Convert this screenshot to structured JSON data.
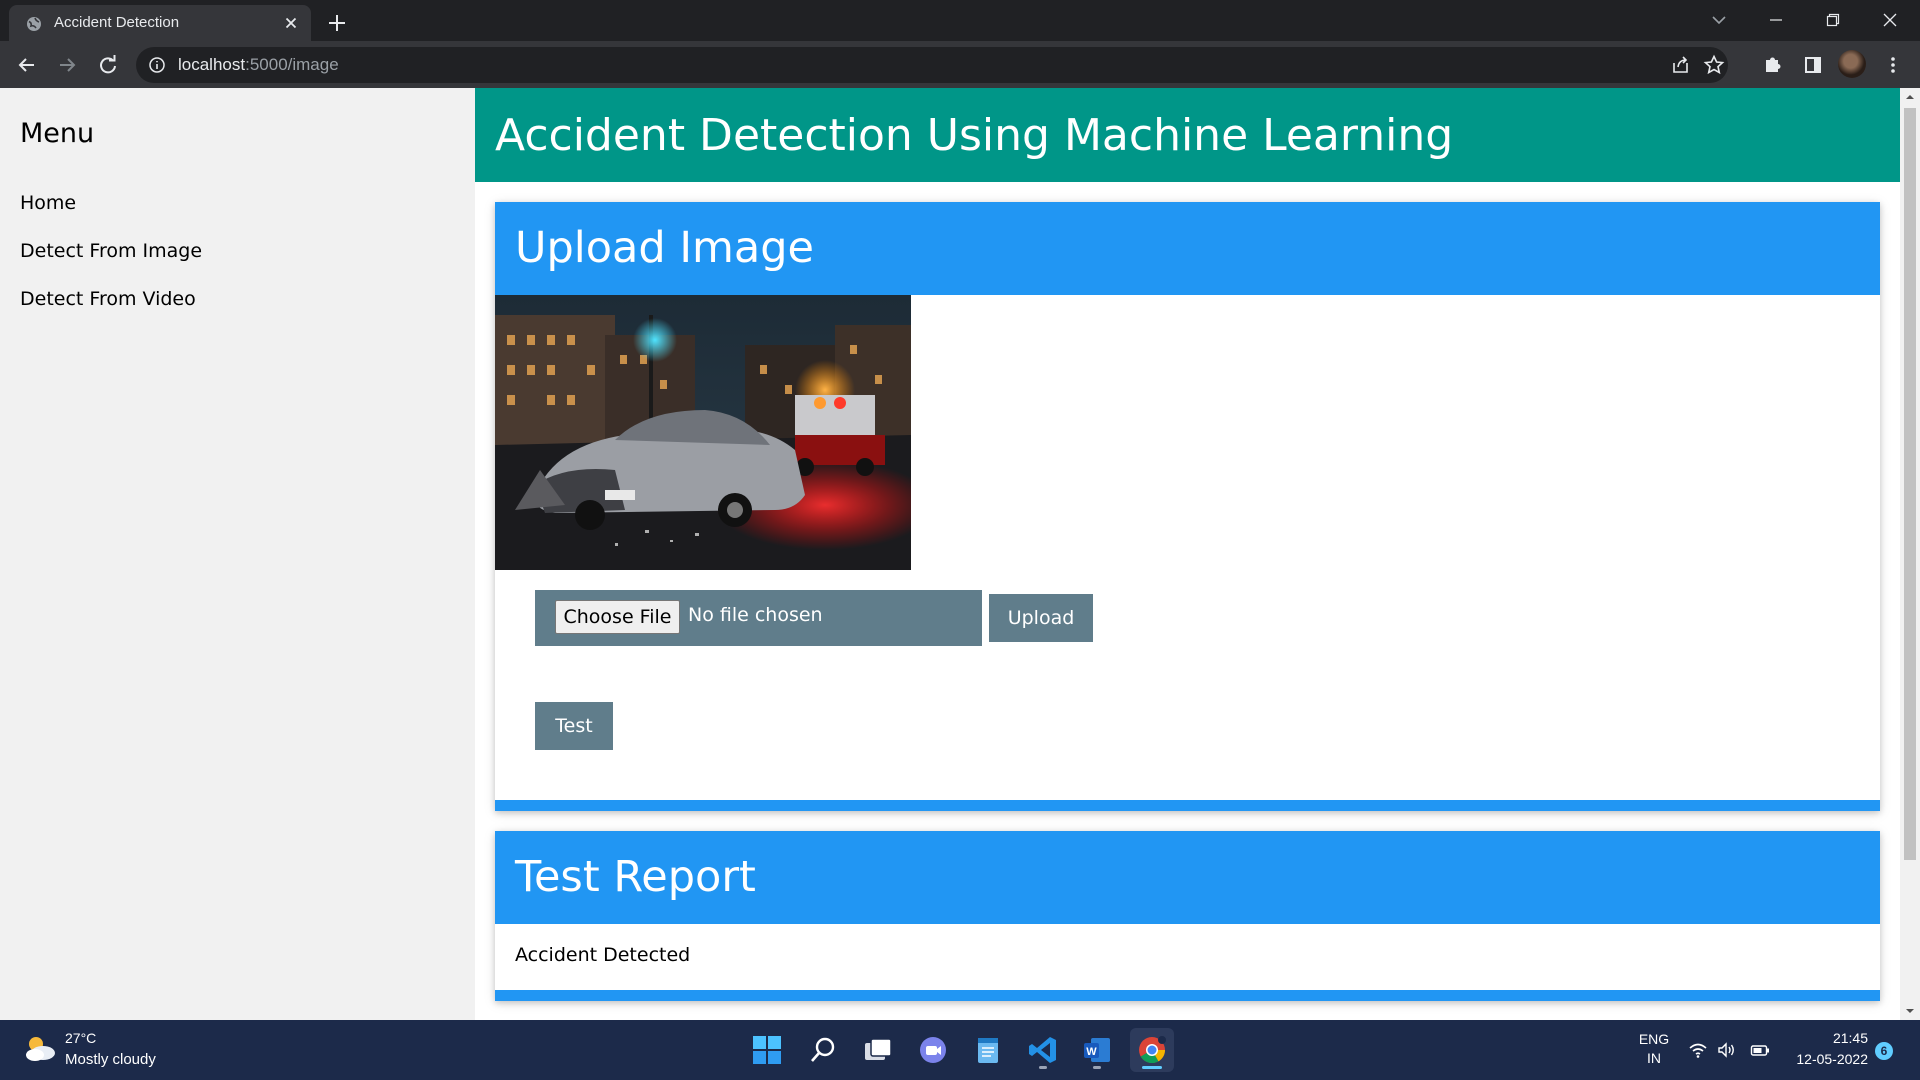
{
  "browser": {
    "tab": {
      "title": "Accident Detection",
      "favicon": "globe-icon"
    },
    "address": {
      "host": "localhost",
      "path": ":5000/image"
    },
    "icons": [
      "back-arrow-icon",
      "forward-arrow-icon",
      "reload-icon",
      "info-icon",
      "share-icon",
      "star-icon",
      "extensions-icon",
      "side-panel-icon",
      "more-vert-icon",
      "new-tab-icon",
      "tab-search-icon",
      "minimize-icon",
      "restore-icon",
      "close-icon"
    ]
  },
  "sidebar": {
    "title": "Menu",
    "items": [
      {
        "label": "Home"
      },
      {
        "label": "Detect From Image"
      },
      {
        "label": "Detect From Video"
      }
    ]
  },
  "header": {
    "title": "Accident Detection Using Machine Learning"
  },
  "upload_card": {
    "title": "Upload Image",
    "file_button_label": "Choose File",
    "file_status": "No file chosen",
    "upload_label": "Upload",
    "test_label": "Test"
  },
  "report_card": {
    "title": "Test Report",
    "result": "Accident Detected"
  },
  "taskbar": {
    "weather": {
      "temp": "27°C",
      "desc": "Mostly cloudy"
    },
    "lang": {
      "line1": "ENG",
      "line2": "IN"
    },
    "clock": {
      "time": "21:45",
      "date": "12-05-2022"
    },
    "notifications": "6"
  },
  "colors": {
    "header": "#009688",
    "card_accent": "#2196f3",
    "button": "#607d8b",
    "sidebar_bg": "#f1f1f1"
  }
}
